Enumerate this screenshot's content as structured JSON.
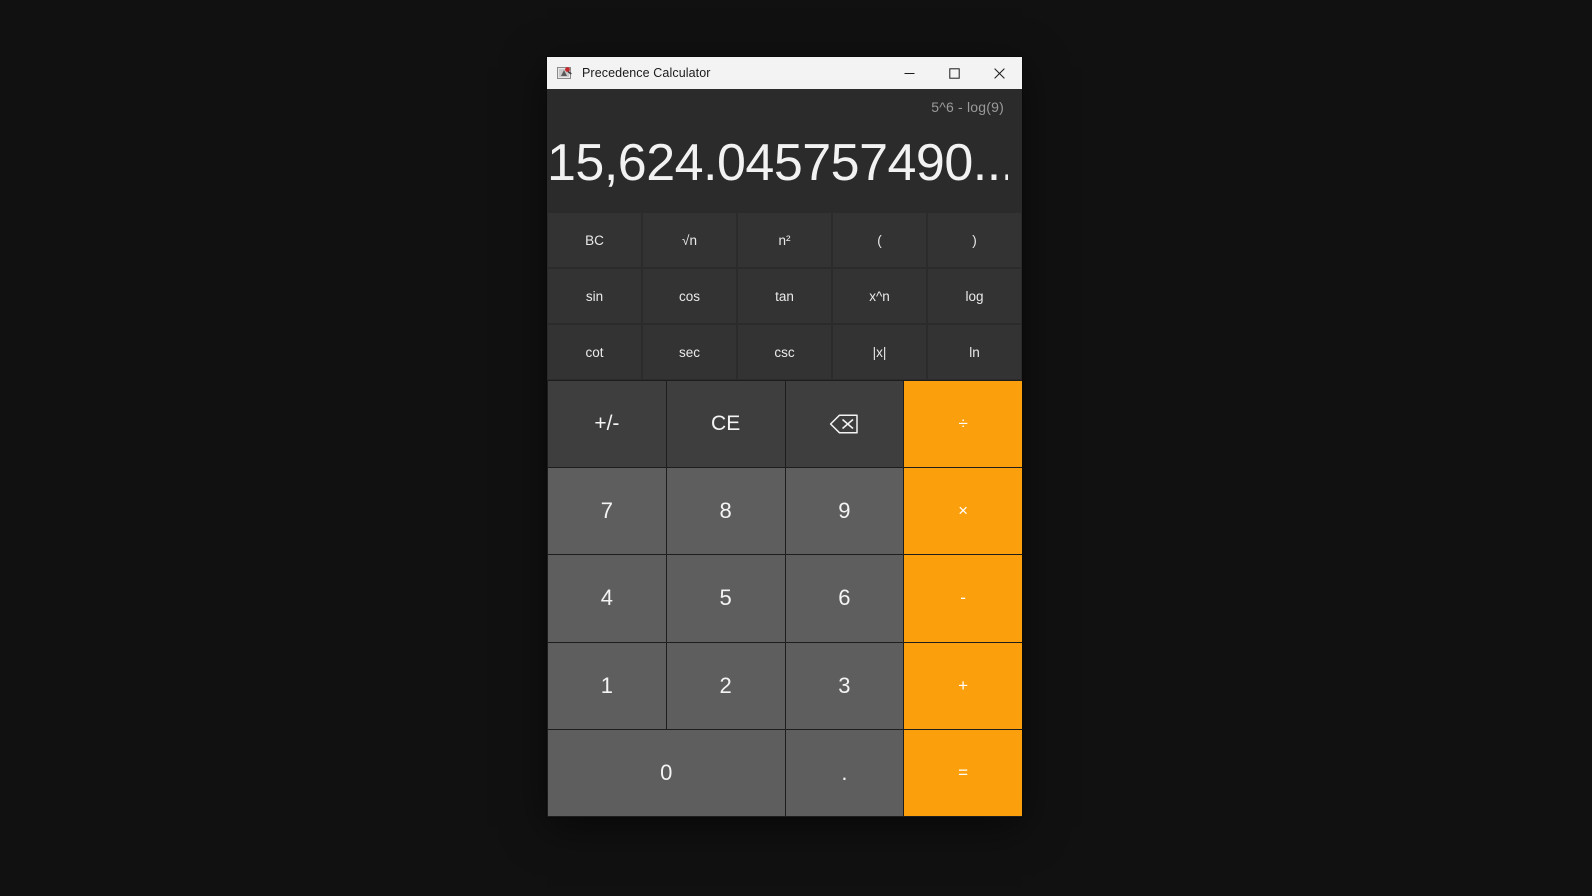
{
  "window": {
    "title": "Precedence Calculator",
    "icon": "calculator-app-icon",
    "controls": {
      "minimize": "minimize-icon",
      "maximize": "maximize-icon",
      "close": "close-icon"
    }
  },
  "display": {
    "expression": "5^6 - log(9)",
    "result": "15,624.045757490..."
  },
  "scientific": [
    {
      "label": "BC",
      "name": "bc-button"
    },
    {
      "label": "√n",
      "name": "sqrt-n-button"
    },
    {
      "label": "n²",
      "name": "n-squared-button"
    },
    {
      "label": "(",
      "name": "open-paren-button"
    },
    {
      "label": ")",
      "name": "close-paren-button"
    },
    {
      "label": "sin",
      "name": "sin-button"
    },
    {
      "label": "cos",
      "name": "cos-button"
    },
    {
      "label": "tan",
      "name": "tan-button"
    },
    {
      "label": "x^n",
      "name": "x-power-n-button"
    },
    {
      "label": "log",
      "name": "log-button"
    },
    {
      "label": "cot",
      "name": "cot-button"
    },
    {
      "label": "sec",
      "name": "sec-button"
    },
    {
      "label": "csc",
      "name": "csc-button"
    },
    {
      "label": "|x|",
      "name": "absolute-value-button"
    },
    {
      "label": "ln",
      "name": "ln-button"
    }
  ],
  "keypad": {
    "plus_minus": "+/-",
    "clear_entry": "CE",
    "backspace": "backspace-icon",
    "divide": "÷",
    "seven": "7",
    "eight": "8",
    "nine": "9",
    "multiply": "×",
    "four": "4",
    "five": "5",
    "six": "6",
    "subtract": "-",
    "one": "1",
    "two": "2",
    "three": "3",
    "add": "+",
    "zero": "0",
    "decimal": ".",
    "equals": "="
  },
  "colors": {
    "accent_orange": "#fba00c",
    "number_key": "#5e5e5e",
    "function_key": "#3e3e3e",
    "scientific_key": "#333333",
    "display_bg": "#2b2b2b",
    "titlebar_bg": "#f3f3f3",
    "desktop_bg": "#111111"
  }
}
